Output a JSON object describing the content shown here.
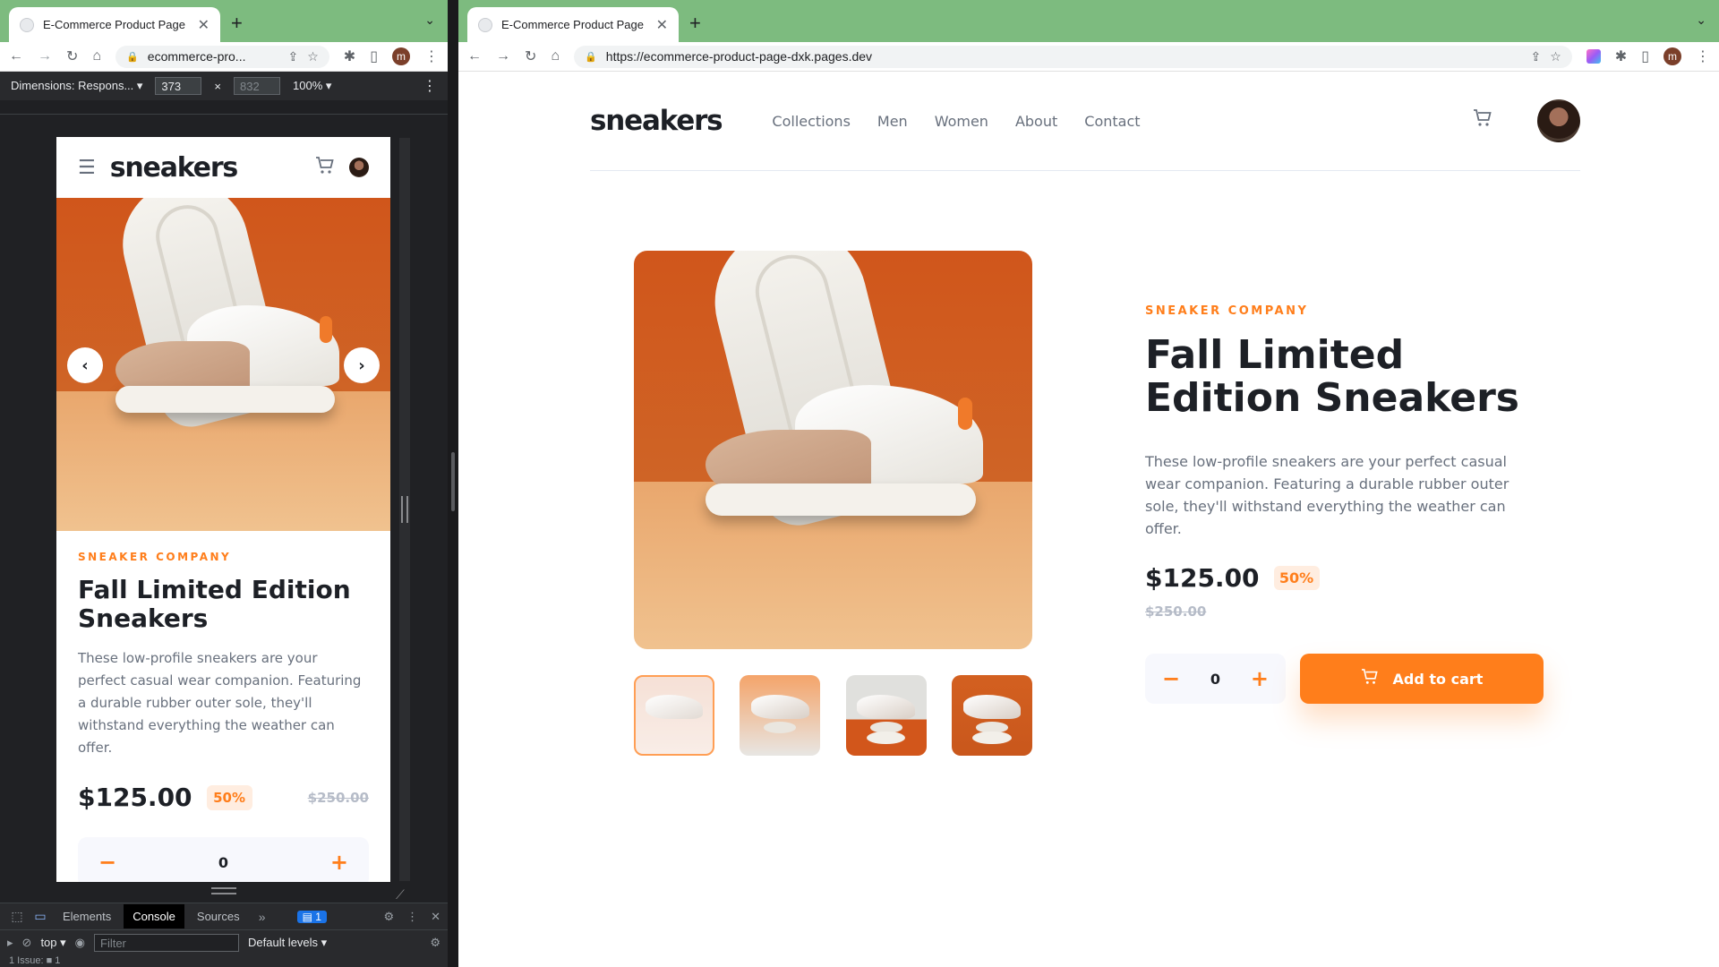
{
  "left_browser": {
    "tab_title": "E-Commerce Product Page",
    "url": "ecommerce-pro...",
    "profile_initial": "m",
    "device": {
      "dimensions_label": "Dimensions: Respons...",
      "width": "373",
      "height_placeholder": "832",
      "zoom": "100%"
    },
    "devtools": {
      "tabs": [
        "Elements",
        "Console",
        "Sources"
      ],
      "active_tab": "Console",
      "badge": "1",
      "context": "top",
      "filter_placeholder": "Filter",
      "levels": "Default levels",
      "issues": "1 Issue: ■ 1"
    }
  },
  "right_browser": {
    "tab_title": "E-Commerce Product Page",
    "url": "https://ecommerce-product-page-dxk.pages.dev",
    "profile_initial": "m"
  },
  "shop": {
    "brand": "sneakers",
    "nav": [
      "Collections",
      "Men",
      "Women",
      "About",
      "Contact"
    ],
    "company": "SNEAKER COMPANY",
    "title": "Fall Limited Edition Sneakers",
    "description": "These low-profile sneakers are your perfect casual wear companion. Featuring a durable rubber outer sole, they'll withstand everything the weather can offer.",
    "price": "$125.00",
    "discount": "50%",
    "old_price": "$250.00",
    "quantity": "0",
    "minus": "−",
    "plus": "+",
    "add_to_cart": "Add to cart",
    "prev_arrow": "‹",
    "next_arrow": "›",
    "active_thumbnail": 1
  },
  "colors": {
    "orange": "#ff7e1b",
    "pale_orange": "#ffede0",
    "very_dark_blue": "#1d2026",
    "dark_grayish_blue": "#68707d",
    "grayish_blue": "#b6bcc8",
    "light_grayish_blue": "#f7f8fd"
  }
}
